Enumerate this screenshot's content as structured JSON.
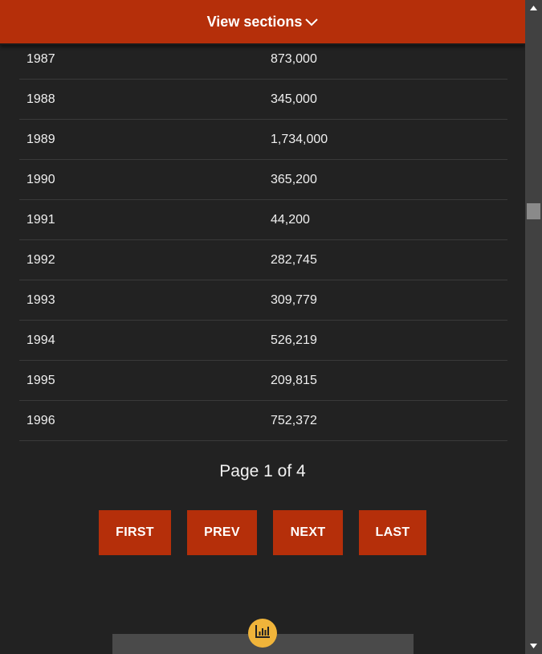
{
  "header": {
    "view_sections_label": "View sections"
  },
  "table": {
    "rows": [
      {
        "year": "1987",
        "value": "873,000"
      },
      {
        "year": "1988",
        "value": "345,000"
      },
      {
        "year": "1989",
        "value": "1,734,000"
      },
      {
        "year": "1990",
        "value": "365,200"
      },
      {
        "year": "1991",
        "value": "44,200"
      },
      {
        "year": "1992",
        "value": "282,745"
      },
      {
        "year": "1993",
        "value": "309,779"
      },
      {
        "year": "1994",
        "value": "526,219"
      },
      {
        "year": "1995",
        "value": "209,815"
      },
      {
        "year": "1996",
        "value": "752,372"
      }
    ]
  },
  "pagination": {
    "page_info": "Page 1 of 4",
    "first_label": "FIRST",
    "prev_label": "PREV",
    "next_label": "NEXT",
    "last_label": "LAST"
  },
  "icons": {
    "chevron": "chevron-down-icon",
    "chart": "bar-chart-icon"
  },
  "colors": {
    "accent": "#b52f0a",
    "background": "#222222",
    "fab": "#f0b43a"
  }
}
